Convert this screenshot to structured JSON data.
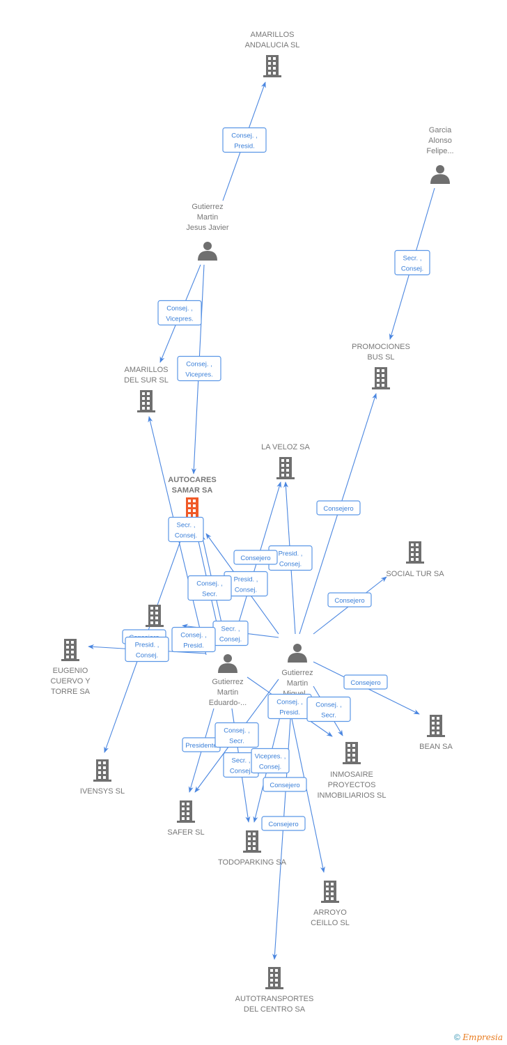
{
  "nodes": [
    {
      "id": "amarillos_andalucia",
      "type": "company",
      "label": [
        "AMARILLOS",
        "ANDALUCIA SL"
      ]
    },
    {
      "id": "garcia",
      "type": "person",
      "label": [
        "Garcia",
        "Alonso",
        "Felipe..."
      ]
    },
    {
      "id": "gutierrez_jesus",
      "type": "person",
      "label": [
        "Gutierrez",
        "Martin",
        "Jesus Javier"
      ]
    },
    {
      "id": "promociones_bus",
      "type": "company",
      "label": [
        "PROMOCIONES",
        "BUS SL"
      ]
    },
    {
      "id": "amarillos_sur",
      "type": "company",
      "label": [
        "AMARILLOS",
        "DEL SUR SL"
      ]
    },
    {
      "id": "la_veloz",
      "type": "company",
      "label": [
        "LA VELOZ SA"
      ]
    },
    {
      "id": "autocares_samar",
      "type": "company",
      "main": true,
      "label": [
        "AUTOCARES",
        "SAMAR SA"
      ]
    },
    {
      "id": "social_tur",
      "type": "company",
      "label": [
        "SOCIAL TUR SA"
      ]
    },
    {
      "id": "hidden_company",
      "type": "company",
      "label": []
    },
    {
      "id": "eugenio",
      "type": "company",
      "label": [
        "EUGENIO",
        "CUERVO Y",
        "TORRE SA"
      ]
    },
    {
      "id": "gutierrez_eduardo",
      "type": "person",
      "label": [
        "Gutierrez",
        "Martin",
        "Eduardo-..."
      ]
    },
    {
      "id": "gutierrez_miguel",
      "type": "person",
      "label": [
        "Gutierrez",
        "Martin",
        "Miguel..."
      ]
    },
    {
      "id": "bean",
      "type": "company",
      "label": [
        "BEAN SA"
      ]
    },
    {
      "id": "inmosaire",
      "type": "company",
      "label": [
        "INMOSAIRE",
        "PROYECTOS",
        "INMOBILIARIOS SL"
      ]
    },
    {
      "id": "ivensys",
      "type": "company",
      "label": [
        "IVENSYS SL"
      ]
    },
    {
      "id": "safer",
      "type": "company",
      "label": [
        "SAFER SL"
      ]
    },
    {
      "id": "todoparking",
      "type": "company",
      "label": [
        "TODOPARKING SA"
      ]
    },
    {
      "id": "arroyo",
      "type": "company",
      "label": [
        "ARROYO",
        "CEILLO SL"
      ]
    },
    {
      "id": "autotransportes",
      "type": "company",
      "label": [
        "AUTOTRANSPORTES",
        "DEL CENTRO SA"
      ]
    }
  ],
  "edges": [
    {
      "from": "gutierrez_jesus",
      "to": "amarillos_andalucia",
      "label": [
        "Consej. ,",
        "Presid."
      ]
    },
    {
      "from": "garcia",
      "to": "promociones_bus",
      "label": [
        "Secr. ,",
        "Consej."
      ]
    },
    {
      "from": "gutierrez_jesus",
      "to": "amarillos_sur",
      "label": [
        "Consej. ,",
        "Vicepres."
      ]
    },
    {
      "from": "gutierrez_jesus",
      "to": "autocares_samar",
      "label": [
        "Consej. ,",
        "Vicepres."
      ]
    },
    {
      "from": "gutierrez_eduardo",
      "to": "amarillos_sur",
      "label": [
        "Secr. ,",
        "Consej."
      ]
    },
    {
      "from": "autocares_samar",
      "to": "ivensys",
      "label": [
        "Consejero"
      ]
    },
    {
      "from": "gutierrez_miguel",
      "to": "autocares_samar",
      "label": [
        "Presid. ,",
        "Consej."
      ]
    },
    {
      "from": "gutierrez_eduardo",
      "to": "autocares_samar",
      "label": [
        "Consej. ,",
        "Secr."
      ]
    },
    {
      "from": "gutierrez_eduardo",
      "to": "autocares_samar",
      "label": [
        "Secr. ,",
        "Consej."
      ]
    },
    {
      "from": "gutierrez_miguel",
      "to": "la_veloz",
      "label": [
        "Presid. ,",
        "Consej."
      ]
    },
    {
      "from": "gutierrez_eduardo",
      "to": "la_veloz",
      "label": [
        "Consejero"
      ]
    },
    {
      "from": "gutierrez_miguel",
      "to": "promociones_bus",
      "label": [
        "Consejero"
      ]
    },
    {
      "from": "gutierrez_miguel",
      "to": "social_tur",
      "label": [
        "Consejero"
      ]
    },
    {
      "from": "gutierrez_miguel",
      "to": "hidden_company",
      "label": [
        "Consej. ,",
        "Presid."
      ]
    },
    {
      "from": "gutierrez_eduardo",
      "to": "eugenio",
      "label": [
        "Presid. ,",
        "Consej."
      ]
    },
    {
      "from": "gutierrez_miguel",
      "to": "bean",
      "label": [
        "Consejero"
      ]
    },
    {
      "from": "gutierrez_eduardo",
      "to": "inmosaire",
      "label": [
        "Consej. ,",
        "Presid."
      ]
    },
    {
      "from": "gutierrez_miguel",
      "to": "inmosaire",
      "label": [
        "Consej. ,",
        "Secr."
      ]
    },
    {
      "from": "gutierrez_eduardo",
      "to": "safer",
      "label": [
        "Presidente"
      ]
    },
    {
      "from": "gutierrez_miguel",
      "to": "safer",
      "label": [
        "Consej. ,",
        "Secr."
      ]
    },
    {
      "from": "gutierrez_eduardo",
      "to": "todoparking",
      "label": [
        "Secr. ,",
        "Consej."
      ]
    },
    {
      "from": "gutierrez_miguel",
      "to": "todoparking",
      "label": [
        "Vicepres. ,",
        "Consej."
      ]
    },
    {
      "from": "gutierrez_miguel",
      "to": "arroyo",
      "label": [
        "Consejero"
      ]
    },
    {
      "from": "gutierrez_miguel",
      "to": "autotransportes",
      "label": [
        "Consejero"
      ]
    }
  ],
  "colors": {
    "edge": "#4a86e0",
    "icon": "#6f6f6f",
    "main_icon": "#f05a28",
    "label": "#777777"
  },
  "footer": {
    "copyright": "©",
    "brand": "Empresia"
  }
}
